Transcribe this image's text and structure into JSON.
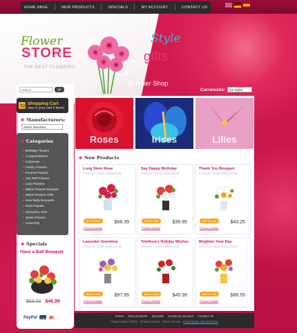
{
  "top_nav": [
    "HOME PAGE",
    "NEW PRODUCTS",
    "SPECIALS",
    "MY ACCOUNT",
    "CONTACT US"
  ],
  "flags": [
    "uk-flag-icon",
    "germany-flag-icon",
    "spain-flag-icon"
  ],
  "logo": {
    "line1": "Flower",
    "line2": "STORE",
    "tagline": "THE BEST FLOWERS!"
  },
  "hero": {
    "style": "Style",
    "gifts": "gifts",
    "enter_shop": "Enter Shop"
  },
  "currencies": {
    "label": "Currencies:",
    "selected": "US Dollar"
  },
  "search": {
    "placeholder": "Search",
    "button": "go"
  },
  "cart": {
    "title": "Shopping Cart",
    "subtitle": "now in your cart 0 items"
  },
  "manufacturers": {
    "title": "Manufacturers:",
    "selected": "Select Manufact..."
  },
  "categories": {
    "title": "Categories",
    "items": [
      "Birthday Flowers",
      "Congratulations",
      "Corporate",
      "Family Flowers",
      "Funeral Flowers",
      "Get Well Flowers",
      "Love Flowers",
      "Miami Flowers Bouquet",
      "Miami Flowers Gifts",
      "New Baby Bouquets",
      "Most Popular",
      "Sympathy Gifts",
      "Week Flowers",
      "University"
    ]
  },
  "specials": {
    "title": "Specials",
    "name": "Have a Ball Bouquet",
    "old_price": "$55.00",
    "new_price": "$46.99"
  },
  "payment": {
    "paypal": "PayPal"
  },
  "banners": [
    "Roses",
    "Irises",
    "Lilies"
  ],
  "new_products": {
    "title": "New Products",
    "add_label": "Add To Cart",
    "details_label": "Product Details",
    "model_text": "PRODUCT CODE 1DEBLAST36",
    "items": [
      {
        "name": "Long Stem Rose",
        "price": "$68.39"
      },
      {
        "name": "Say Happy Birthday",
        "price": "$39.95"
      },
      {
        "name": "Thank You Bouquet",
        "price": "$43.25"
      },
      {
        "name": "Lavender Sunshine",
        "price": "$97.95"
      },
      {
        "name": "Teleflora's Holiday Wishes",
        "price": "$45.99"
      },
      {
        "name": "Brighten Your Day",
        "price": "$88.55"
      }
    ]
  },
  "footer": {
    "links": [
      "Home",
      "New products",
      "Specials",
      "Create an account",
      "Contact Us"
    ],
    "copy": "Flower Store ©2012",
    "privacy": "Privacy Notice",
    "terms": "Terms of Use",
    "powered": "Powered by osCommerce"
  },
  "colors": {
    "brand": "#c8174c",
    "accent": "#f5a623",
    "dark": "#2b2b2b"
  }
}
